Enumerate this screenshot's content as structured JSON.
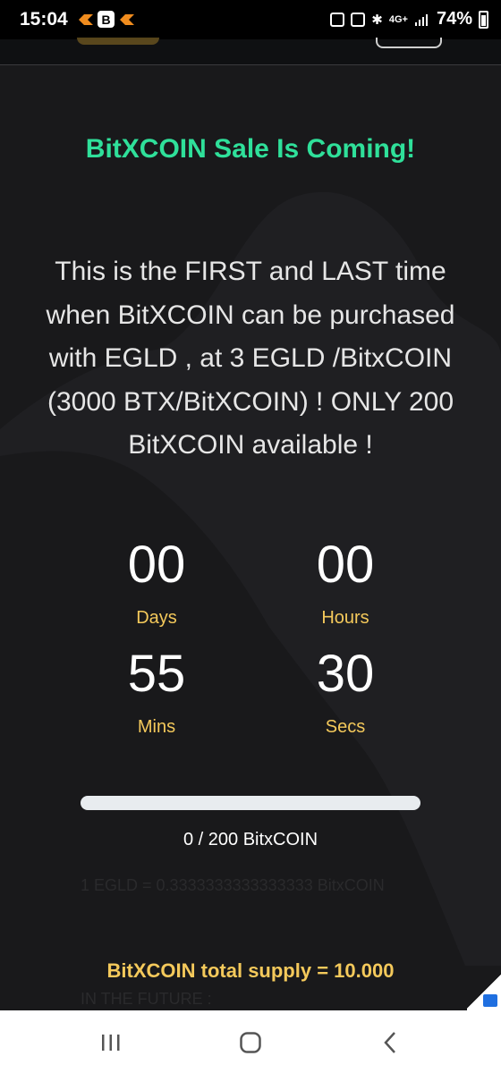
{
  "status_bar": {
    "time": "15:04",
    "battery": "74%",
    "network": "4G+"
  },
  "main": {
    "title": "BitXCOIN Sale Is Coming!",
    "description": "This is the FIRST and LAST time when BitXCOIN can be purchased with EGLD , at 3 EGLD /BitxCOIN (3000 BTX/BitXCOIN) ! ONLY 200 BitXCOIN available !",
    "countdown": {
      "days_value": "00",
      "days_label": "Days",
      "hours_value": "00",
      "hours_label": "Hours",
      "mins_value": "55",
      "mins_label": "Mins",
      "secs_value": "30",
      "secs_label": "Secs"
    },
    "progress": {
      "fraction": 0,
      "text": "0 / 200 BitxCOIN"
    },
    "rate": "1 EGLD = 0.3333333333333333 BitxCOIN",
    "supply": "BitXCOIN total supply = 10.000",
    "future": "IN THE FUTURE :"
  },
  "colors": {
    "accent_green": "#2fe09a",
    "accent_gold": "#f4c95b",
    "background": "#19191b"
  }
}
